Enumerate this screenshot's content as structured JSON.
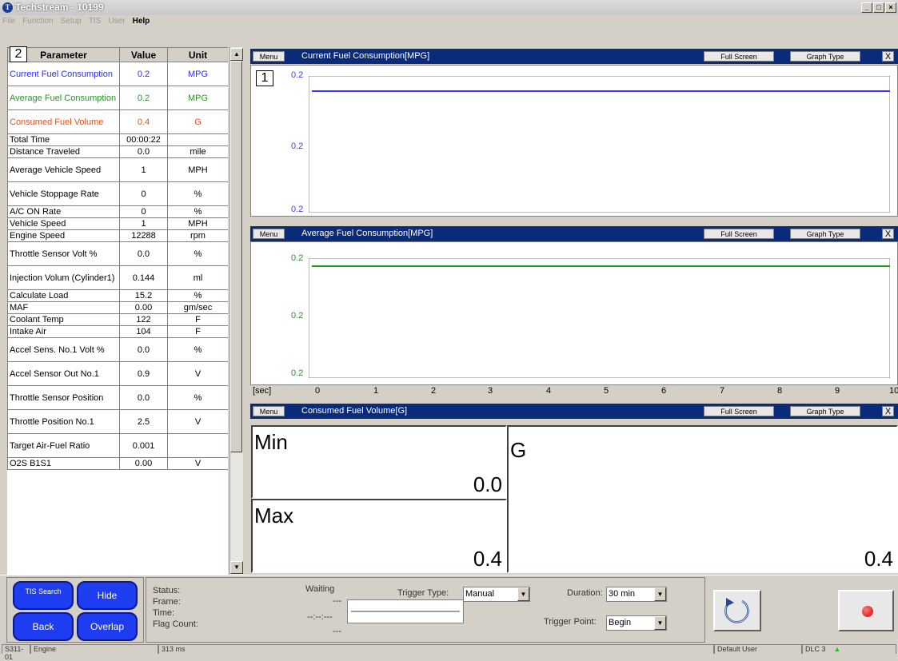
{
  "window": {
    "title": "Techstream - 10199",
    "icon_letter": "T",
    "min": "_",
    "max": "□",
    "close": "×"
  },
  "menu": [
    "File",
    "Function",
    "Setup",
    "TIS",
    "User",
    "Help"
  ],
  "table": {
    "badge": "2",
    "headers": [
      "Parameter",
      "Value",
      "Unit"
    ],
    "rows": [
      {
        "param": "Current Fuel Consumption",
        "value": "0.2",
        "unit": "MPG",
        "color": "#2a2aff"
      },
      {
        "param": "Average Fuel Consumption",
        "value": "0.2",
        "unit": "MPG",
        "color": "#1f9a1f"
      },
      {
        "param": "Consumed Fuel Volume",
        "value": "0.4",
        "unit": "G",
        "color": "#e0501a"
      },
      {
        "param": "Total Time",
        "value": "00:00:22",
        "unit": ""
      },
      {
        "param": "Distance Traveled",
        "value": "0.0",
        "unit": "mile"
      },
      {
        "param": "Average Vehicle Speed",
        "value": "1",
        "unit": "MPH"
      },
      {
        "param": "Vehicle Stoppage Rate",
        "value": "0",
        "unit": "%"
      },
      {
        "param": "A/C ON Rate",
        "value": "0",
        "unit": "%"
      },
      {
        "param": "Vehicle Speed",
        "value": "1",
        "unit": "MPH"
      },
      {
        "param": "Engine Speed",
        "value": "12288",
        "unit": "rpm"
      },
      {
        "param": "Throttle Sensor Volt %",
        "value": "0.0",
        "unit": "%"
      },
      {
        "param": "Injection Volum (Cylinder1)",
        "value": "0.144",
        "unit": "ml"
      },
      {
        "param": "Calculate Load",
        "value": "15.2",
        "unit": "%"
      },
      {
        "param": "MAF",
        "value": "0.00",
        "unit": "gm/sec"
      },
      {
        "param": "Coolant Temp",
        "value": "122",
        "unit": "F"
      },
      {
        "param": "Intake Air",
        "value": "104",
        "unit": "F"
      },
      {
        "param": "Accel Sens. No.1 Volt %",
        "value": "0.0",
        "unit": "%"
      },
      {
        "param": "Accel Sensor Out No.1",
        "value": "0.9",
        "unit": "V"
      },
      {
        "param": "Throttle Sensor Position",
        "value": "0.0",
        "unit": "%"
      },
      {
        "param": "Throttle Position No.1",
        "value": "2.5",
        "unit": "V"
      },
      {
        "param": "Target Air-Fuel Ratio",
        "value": "0.001",
        "unit": ""
      },
      {
        "param": "O2S B1S1",
        "value": "0.00",
        "unit": "V"
      }
    ]
  },
  "scroll": {
    "up": "▲",
    "down": "▼"
  },
  "panel1": {
    "badge": "1",
    "menu": "Menu",
    "title": "Current Fuel Consumption[MPG]",
    "fullscreen": "Full Screen",
    "graphtype": "Graph Type",
    "close": "X",
    "yticks": [
      "0.2",
      "0.2",
      "0.2"
    ],
    "line_color": "#3a3af0",
    "level": 0.92
  },
  "panel2": {
    "menu": "Menu",
    "title": "Average Fuel Consumption[MPG]",
    "fullscreen": "Full Screen",
    "graphtype": "Graph Type",
    "close": "X",
    "yticks": [
      "0.2",
      "0.2",
      "0.2"
    ],
    "line_color": "#1f9a1f",
    "level": 0.92
  },
  "xaxis": {
    "unit": "[sec]",
    "ticks": [
      "0",
      "1",
      "2",
      "3",
      "4",
      "5",
      "6",
      "7",
      "8",
      "9",
      "10"
    ]
  },
  "panel3": {
    "menu": "Menu",
    "title": "Consumed Fuel Volume[G]",
    "fullscreen": "Full Screen",
    "graphtype": "Graph Type",
    "close": "X",
    "min_label": "Min",
    "min_value": "0.0",
    "max_label": "Max",
    "max_value": "0.4",
    "unit_label": "G",
    "current_value": "0.4"
  },
  "buttons": {
    "tis": "TIS Search",
    "hide": "Hide",
    "back": "Back",
    "overlap": "Overlap"
  },
  "status": {
    "status_label": "Status:",
    "frame_label": "Frame:",
    "time_label": "Time:",
    "flag_label": "Flag Count:",
    "status_value": "Waiting",
    "frame_value": "---",
    "time_value": "--:--:---",
    "flag_value": "---"
  },
  "trigger": {
    "type_label": "Trigger Type:",
    "type_value": "Manual",
    "duration_label": "Duration:",
    "duration_value": "30 min",
    "point_label": "Trigger Point:",
    "point_value": "Begin"
  },
  "statusbar": {
    "ecu": "S311-01",
    "system": "Engine",
    "latency": "313 ms",
    "user": "Default User",
    "dlc": "DLC 3"
  }
}
